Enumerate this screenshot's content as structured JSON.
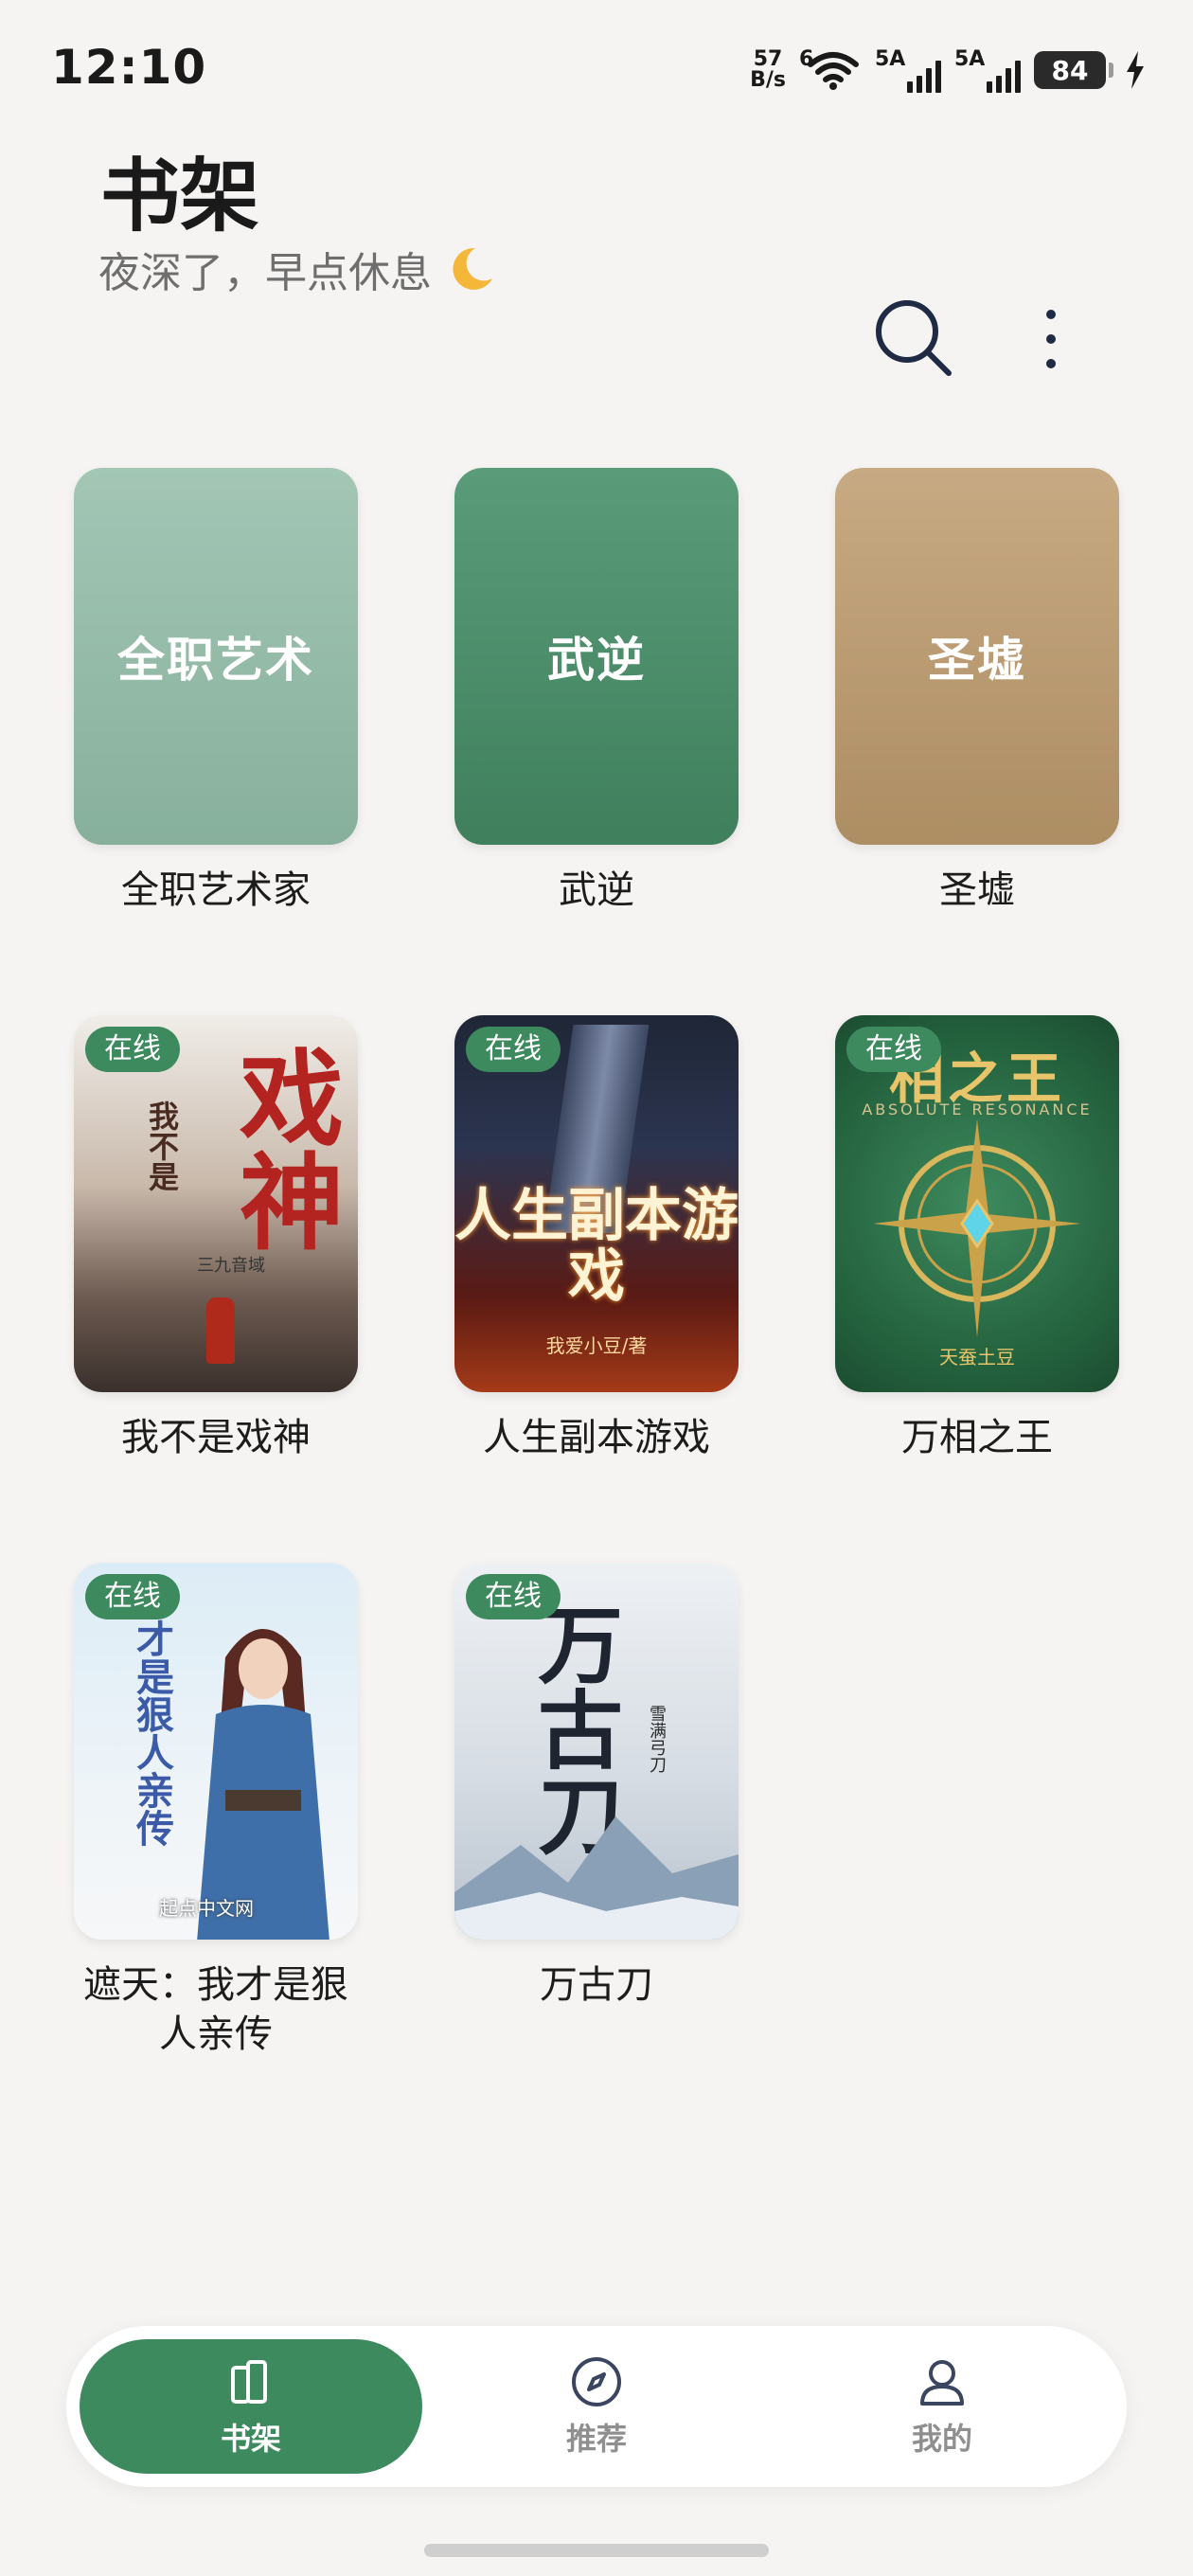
{
  "status_bar": {
    "time": "12:10",
    "net_speed_value": "57",
    "net_speed_unit": "B/s",
    "wifi_tag": "6",
    "sim1_tag": "5A",
    "sim2_tag": "5A",
    "battery": "84"
  },
  "header": {
    "title": "书架",
    "greeting": "夜深了，早点休息"
  },
  "books": [
    {
      "cover_text": "全职艺术",
      "title": "全职艺术家",
      "online_badge": ""
    },
    {
      "cover_text": "武逆",
      "title": "武逆",
      "online_badge": ""
    },
    {
      "cover_text": "圣墟",
      "title": "圣墟",
      "online_badge": ""
    },
    {
      "cover_art": {
        "big": "戏神",
        "small": "我不是",
        "author": "三九音域"
      },
      "title": "我不是戏神",
      "online_badge": "在线"
    },
    {
      "cover_art": {
        "title": "人生副本游戏",
        "author": "我爱小豆/著"
      },
      "title": "人生副本游戏",
      "online_badge": "在线"
    },
    {
      "cover_art": {
        "title": "相之王",
        "sub": "ABSOLUTE RESONANCE",
        "author": "天蚕土豆"
      },
      "title": "万相之王",
      "online_badge": "在线"
    },
    {
      "cover_art": {
        "col": "才是狠人亲传",
        "brand": "起点中文网"
      },
      "title": "遮天：我才是狠人亲传",
      "online_badge": "在线"
    },
    {
      "cover_art": {
        "title": "万古刀",
        "author": "雪满弓刀"
      },
      "title": "万古刀",
      "online_badge": "在线"
    }
  ],
  "bottom_nav": {
    "items": [
      {
        "label": "书架",
        "icon": "bookshelf-icon",
        "active": true
      },
      {
        "label": "推荐",
        "icon": "compass-icon",
        "active": false
      },
      {
        "label": "我的",
        "icon": "profile-icon",
        "active": false
      }
    ]
  },
  "colors": {
    "accent": "#3d8a5e",
    "background": "#f5f4f2",
    "cover_sage": "#95bba9",
    "cover_green": "#4c8e6b",
    "cover_tan": "#ba9c73"
  }
}
